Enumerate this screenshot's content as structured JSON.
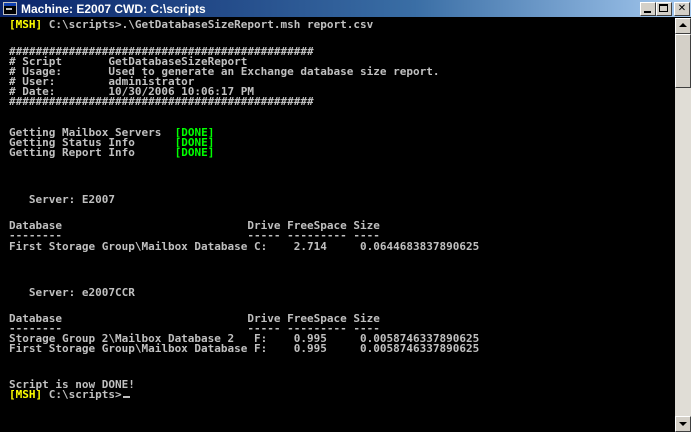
{
  "window": {
    "title": "Machine: E2007 CWD: C:\\scripts",
    "icon": "console-window-icon",
    "controls": [
      "minimize-icon",
      "maximize-icon",
      "close-icon"
    ]
  },
  "console": {
    "prompt_tag": "[MSH]",
    "command": " C:\\scripts>.\\GetDatabaseSizeReport.msh report.csv",
    "banner_top": "##############################################",
    "header": {
      "script": "# Script       GetDatabaseSizeReport",
      "usage": "# Usage:       Used to generate an Exchange database size report.",
      "user": "# User:        administrator",
      "date": "# Date:        10/30/2006 10:06:17 PM"
    },
    "banner_bottom": "##############################################",
    "steps": [
      {
        "label": "Getting Mailbox Servers  ",
        "status": "[DONE]"
      },
      {
        "label": "Getting Status Info      ",
        "status": "[DONE]"
      },
      {
        "label": "Getting Report Info      ",
        "status": "[DONE]"
      }
    ],
    "server1": {
      "heading": "   Server: E2007",
      "col_header": "Database                            Drive FreeSpace Size",
      "col_rule": "--------                            ----- --------- ----",
      "rows": [
        "First Storage Group\\Mailbox Database C:    2.714     0.0644683837890625"
      ]
    },
    "server2": {
      "heading": "   Server: e2007CCR",
      "col_header": "Database                            Drive FreeSpace Size",
      "col_rule": "--------                            ----- --------- ----",
      "rows": [
        "Storage Group 2\\Mailbox Database 2   F:    0.995     0.0058746337890625",
        "First Storage Group\\Mailbox Database F:    0.995     0.0058746337890625"
      ]
    },
    "done_message": "Script is now DONE!",
    "final_prompt": " C:\\scripts>"
  },
  "colors": {
    "background": "#000000",
    "text": "#c0c0c0",
    "prompt": "#ffff00",
    "success": "#00ff00"
  }
}
